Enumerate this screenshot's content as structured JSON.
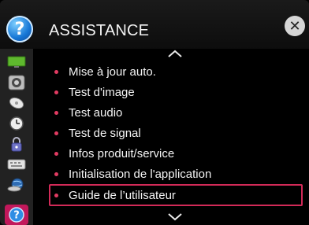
{
  "header": {
    "title": "ASSISTANCE",
    "help_icon": "help-question-icon",
    "close_icon": "close-x-icon"
  },
  "sidebar": {
    "items": [
      {
        "icon": "screen-icon",
        "selected": false
      },
      {
        "icon": "speaker-icon",
        "selected": false
      },
      {
        "icon": "satellite-dish-icon",
        "selected": false
      },
      {
        "icon": "clock-icon",
        "selected": false
      },
      {
        "icon": "lock-icon",
        "selected": false
      },
      {
        "icon": "keyboard-icon",
        "selected": false
      },
      {
        "icon": "network-globe-icon",
        "selected": false
      },
      {
        "icon": "help-icon",
        "selected": true
      }
    ]
  },
  "menu": {
    "items": [
      {
        "label": "Mise à jour auto."
      },
      {
        "label": "Test d'image"
      },
      {
        "label": "Test audio"
      },
      {
        "label": "Test de signal"
      },
      {
        "label": "Infos produit/service"
      },
      {
        "label": "Initialisation de l'application"
      },
      {
        "label": "Guide de l’utilisateur"
      }
    ],
    "selected_index": 6
  },
  "colors": {
    "accent": "#d22a58",
    "bullet": "#e23b62",
    "selected_sidebar": "#c2185b"
  }
}
